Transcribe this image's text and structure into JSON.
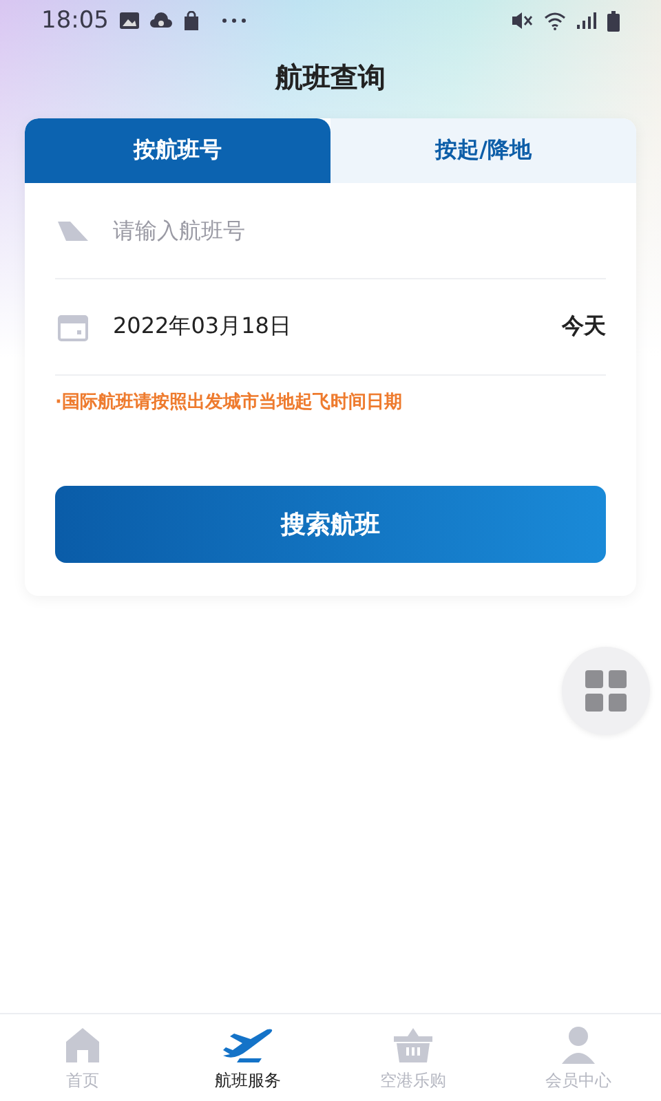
{
  "status_bar": {
    "time": "18:05"
  },
  "title": "航班查询",
  "tabs": [
    {
      "label": "按航班号",
      "selected": true
    },
    {
      "label": "按起/降地",
      "selected": false
    }
  ],
  "flight_field": {
    "placeholder": "请输入航班号"
  },
  "date": {
    "value": "2022年03月18日",
    "note": "今天"
  },
  "notice": "·国际航班请按照出发城市当地起飞时间日期",
  "search_button": "搜索航班",
  "bottom_nav": [
    {
      "kind": "home",
      "label": "首页",
      "selected": false
    },
    {
      "kind": "plane",
      "label": "航班服务",
      "selected": true
    },
    {
      "kind": "basket",
      "label": "空港乐购",
      "selected": false
    },
    {
      "kind": "person",
      "label": "会员中心",
      "selected": false
    }
  ]
}
